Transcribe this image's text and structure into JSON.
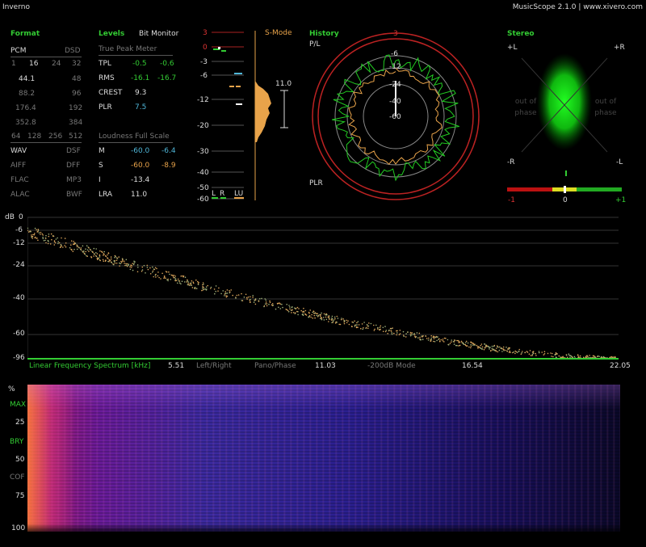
{
  "window": {
    "title": "Inverno",
    "app_title": "MusicScope 2.1.0 | www.xivero.com"
  },
  "format": {
    "header": "Format",
    "pcm_label": "PCM",
    "dsd_label": "DSD",
    "bits": [
      "1",
      "16",
      "24",
      "32"
    ],
    "rates_left": [
      "44.1",
      "88.2",
      "176.4",
      "352.8"
    ],
    "rates_right": [
      "48",
      "96",
      "192",
      "384"
    ],
    "dsd_rates": [
      "64",
      "128",
      "256",
      "512"
    ],
    "formats_left": [
      "WAV",
      "AIFF",
      "FLAC",
      "ALAC"
    ],
    "formats_right": [
      "DSF",
      "DFF",
      "MP3",
      "BWF"
    ]
  },
  "levels": {
    "header": "Levels",
    "bit_monitor": "Bit Monitor",
    "true_peak_label": "True Peak Meter",
    "rows": [
      {
        "label": "TPL",
        "l": "-0.5",
        "r": "-0.6"
      },
      {
        "label": "RMS",
        "l": "-16.1",
        "r": "-16.7"
      },
      {
        "label": "CREST",
        "l": "9.3",
        "r": ""
      },
      {
        "label": "PLR",
        "l": "7.5",
        "r": ""
      }
    ],
    "loudness_label": "Loudness Full Scale",
    "loud_rows": [
      {
        "label": "M",
        "l": "-60.0",
        "r": "-6.4"
      },
      {
        "label": "S",
        "l": "-60.0",
        "r": "-8.9"
      },
      {
        "label": "I",
        "l": "-13.4",
        "r": ""
      },
      {
        "label": "LRA",
        "l": "11.0",
        "r": ""
      }
    ]
  },
  "meter": {
    "smode": "S-Mode",
    "scale": [
      "3",
      "0",
      "-3",
      "-6",
      "-12",
      "-20",
      "-30",
      "-40",
      "-50",
      "-60"
    ],
    "lra_value": "11.0",
    "channels": [
      "L",
      "R",
      "LU"
    ]
  },
  "history": {
    "header": "History",
    "pl": "P/L",
    "plr": "PLR",
    "scale": [
      "3",
      "-6",
      "-12",
      "-24",
      "-40",
      "-60"
    ]
  },
  "stereo": {
    "header": "Stereo",
    "plus_l": "+L",
    "plus_r": "+R",
    "minus_r": "-R",
    "minus_l": "-L",
    "out_of_phase": "out of phase",
    "corr_scale": [
      "-1",
      "0",
      "+1"
    ]
  },
  "spectrum": {
    "db_label": "dB",
    "y_ticks": [
      "0",
      "-6",
      "-12",
      "-24",
      "-40",
      "-60",
      "-96"
    ],
    "x_ticks": [
      "5.51",
      "11.03",
      "16.54",
      "22.05"
    ],
    "title": "Linear Frequency Spectrum [kHz]",
    "buttons": [
      "Left/Right",
      "Pano/Phase",
      "-200dB Mode"
    ]
  },
  "spectrogram": {
    "y_labels": [
      "%",
      "MAX",
      "25",
      "BRY",
      "50",
      "COF",
      "75",
      "100"
    ]
  },
  "colors": {
    "accent_green": "#33cc33",
    "cyan": "#4fb6d8",
    "orange": "#e8a34a",
    "red": "#cc2222"
  }
}
